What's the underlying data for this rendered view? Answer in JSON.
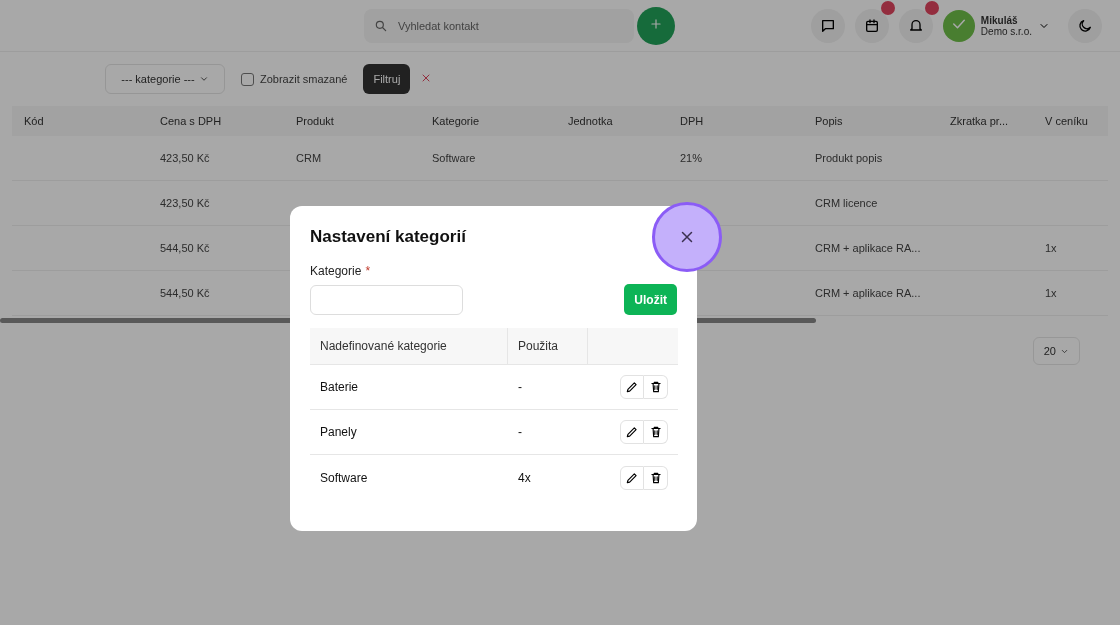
{
  "topbar": {
    "search": {
      "placeholder": "Vyhledat kontakt"
    },
    "badges": [
      {
        "badge": false
      },
      {
        "badge": true
      },
      {
        "badge": true
      }
    ],
    "user": {
      "name": "Mikuláš",
      "company": "Demo s.r.o."
    }
  },
  "filters": {
    "category": "--- kategorie ---",
    "show_deleted": {
      "label": "Zobrazit smazané",
      "checked": false
    },
    "filter_button": "Filtruj"
  },
  "table": {
    "columns": [
      "Kód",
      "Cena s DPH",
      "Produkt",
      "Kategorie",
      "Jednotka",
      "DPH",
      "Popis",
      "Zkratka pr...",
      "V ceníku"
    ],
    "rows": [
      [
        "",
        "423,50 Kč",
        "CRM",
        "Software",
        "",
        "21%",
        "Produkt popis",
        "",
        ""
      ],
      [
        "",
        "423,50 Kč",
        "",
        "",
        "",
        "",
        "CRM licence",
        "",
        ""
      ],
      [
        "",
        "544,50 Kč",
        "",
        "",
        "",
        "",
        "CRM + aplikace RA...",
        "",
        "1x"
      ],
      [
        "",
        "544,50 Kč",
        "",
        "",
        "",
        "",
        "CRM + aplikace RA...",
        "",
        "1x"
      ]
    ],
    "page_size": "20"
  },
  "dialog": {
    "title": "Nastavení kategorií",
    "field": {
      "label": "Kategorie",
      "required_mark": "*"
    },
    "save": "Uložit",
    "columns": [
      "Nadefinované kategorie",
      "Použita"
    ],
    "rows": [
      {
        "name": "Baterie",
        "used": "-"
      },
      {
        "name": "Panely",
        "used": "-"
      },
      {
        "name": "Software",
        "used": "4x"
      }
    ],
    "close_highlighted": true
  }
}
